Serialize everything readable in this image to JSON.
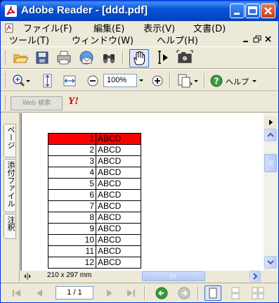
{
  "window": {
    "title": "Adobe Reader - [ddd.pdf]"
  },
  "menubar": {
    "row1": [
      "ファイル(F)",
      "編集(E)",
      "表示(V)",
      "文書(D)"
    ],
    "row2": [
      "ツール(T)",
      "ウィンドウ(W)",
      "ヘルプ(H)"
    ]
  },
  "toolbar": {
    "zoom_value": "100%",
    "help_label": "ヘルプ",
    "web_search_label": "Web 検索",
    "yahoo_label": "Y!"
  },
  "navpane": {
    "tabs": [
      "ページ",
      "添付ファイル",
      "注釈"
    ]
  },
  "document": {
    "rows": [
      {
        "num": "1",
        "text": "ABCD",
        "highlighted": true
      },
      {
        "num": "2",
        "text": "ABCD",
        "highlighted": false
      },
      {
        "num": "3",
        "text": "ABCD",
        "highlighted": false
      },
      {
        "num": "4",
        "text": "ABCD",
        "highlighted": false
      },
      {
        "num": "5",
        "text": "ABCD",
        "highlighted": false
      },
      {
        "num": "6",
        "text": "ABCD",
        "highlighted": false
      },
      {
        "num": "7",
        "text": "ABCD",
        "highlighted": false
      },
      {
        "num": "8",
        "text": "ABCD",
        "highlighted": false
      },
      {
        "num": "9",
        "text": "ABCD",
        "highlighted": false
      },
      {
        "num": "10",
        "text": "ABCD",
        "highlighted": false
      },
      {
        "num": "11",
        "text": "ABCD",
        "highlighted": false
      },
      {
        "num": "12",
        "text": "ABCD",
        "highlighted": false
      }
    ],
    "highlight_color": "#ff0000"
  },
  "status": {
    "page_size": "210 x 297 mm",
    "page_indicator": "1 / 1"
  },
  "colors": {
    "titlebar": "#0054e3",
    "chrome": "#ece9d8"
  }
}
